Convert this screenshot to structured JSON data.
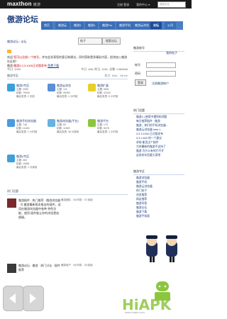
{
  "topbar": {
    "logo": "maxthon",
    "logo_sub": "傲游",
    "login_register": "注册 登录",
    "my_forum": "我的中心 ▾",
    "search_placeholder": "搜索论坛"
  },
  "header": {
    "title": "傲游论坛",
    "subtitle": ""
  },
  "nav": [
    "首页",
    "傲游云",
    "傲游3",
    "傲游4",
    "傲游Pro",
    "傲游手机",
    "傲游云浏览",
    "论坛",
    "公司"
  ],
  "breadcrumb": "傲游论坛 › 论坛",
  "search": {
    "dropdown": "帖子",
    "button": "搜索论坛"
  },
  "login_links": "我的帖子",
  "notice": {
    "line1_prefix": "欢迎",
    "line1_highlight": "您可以注册一个帐号",
    "line1_rest": "，并在此发表您的意见和建议，同时获取更多精彩内容，赶快加入傲游社区吧！",
    "line2_prefix": "傲游",
    "line2_highlight": "傲游3.3.3.1000正式版发布",
    "line2_rest": "免费下载"
  },
  "stats": {
    "left": "今日: 1000",
    "right": "今日: 468, 昨日: 1181, 总数: 1384848"
  },
  "sections": [
    {
      "head": "傲游专区",
      "head_right": "版主: Mail、Minde"
    },
    {
      "head": "热门话题",
      "head_right": ""
    }
  ],
  "boards": [
    {
      "name": "傲游3专区",
      "line1": "主题: 2089",
      "line2": "帖数: 79006",
      "line3": "最后发表: 2 天前"
    },
    {
      "name": "傲游云浏览",
      "line1": "主题: 141",
      "line2": "帖数: 55250",
      "line3": "最后发表: 1 小时前"
    },
    {
      "name": "傲游扩展",
      "line1": "主题: 5581",
      "line2": "帖数: 42430",
      "line3": "最后发表: 5 小时前"
    },
    {
      "name": "傲游手机浏览器",
      "line1": "主题: 748",
      "line2": "帖数: 11453",
      "line3": "最后发表: 1 小时前"
    },
    {
      "name": "傲游浏览器(平台)",
      "line1": "主题: 83",
      "line2": "帖数: 11599",
      "line3": "最后发表: 36 分钟前"
    },
    {
      "name": "傲游平台",
      "line1": "主题: 175",
      "line2": "帖数: 8478",
      "line3": "最后发表: 1 小时前"
    },
    {
      "name": "傲游4专区",
      "line1": "主题: 369",
      "line2": "帖数: 10881",
      "line3": "最后发表: 1 分钟前"
    }
  ],
  "sidebar": {
    "head": "傲游账号",
    "head_right": "",
    "user_label": "帐号",
    "pass_label": "密码",
    "login_btn": "登录",
    "forgot": "注册",
    "remember": "忘记密码",
    "register_link": "注册傲游帐户",
    "hot_head": "热门话题",
    "hot_links": [
      "傲游4 | 使用中遇到的问题",
      "每日推荐插件 · 傲游",
      "傲游，你们的手机浏览器…",
      "傲游云浏览器 beta 1",
      "3.3.3.1000 正式版发布",
      "3.3.1.600 的一个建议",
      "求助 能否出个插件",
      "为何最新的傲游不支持了",
      "傲游 为什么有时打不开",
      "这类的东西要大家吧"
    ],
    "rank_head": "傲游专区",
    "rank_links": [
      "傲游浏览器",
      "傲游手机",
      "傲游云浏览器",
      "热门帖子",
      "浏览推荐",
      "网友推荐",
      "傲游问答",
      "傲游论坛",
      "傲游下载",
      "傲游手机版"
    ]
  },
  "hot_topics": [
    {
      "text": "傲游插件 · 热门推荐 · 傲游浏览器 · 为 傲游最新版本推出的插件，适用在傲游浏览器中各种 特色功能，使用 插件能让你的浏览更加便捷。",
      "meta1": "傲游团队 · 3小时前 · 37 阅读",
      "meta2": ""
    },
    {
      "text": "傲游论坛 · 傲游 · 热门讨论 · 插件推荐",
      "meta1": "傲游用户 · 3小时前 · 28 阅读",
      "meta2": ""
    }
  ],
  "watermark": {
    "brand": "HiAPK",
    "url": "www.hiapk.com"
  }
}
